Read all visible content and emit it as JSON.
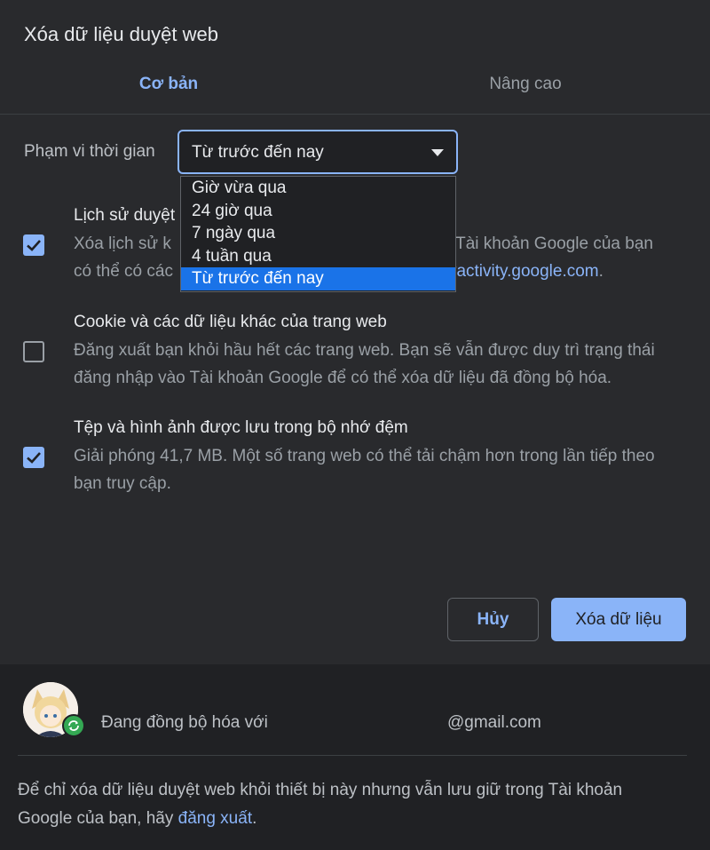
{
  "dialog": {
    "title": "Xóa dữ liệu duyệt web"
  },
  "tabs": [
    {
      "label": "Cơ bản",
      "active": true
    },
    {
      "label": "Nâng cao",
      "active": false
    }
  ],
  "time_range": {
    "label": "Phạm vi thời gian",
    "selected": "Từ trước đến nay",
    "options": [
      "Giờ vừa qua",
      "24 giờ qua",
      "7 ngày qua",
      "4 tuần qua",
      "Từ trước đến nay"
    ]
  },
  "items": [
    {
      "title": "Lịch sử duyệt",
      "desc_line1_start": "Xóa lịch sử k",
      "desc_line1_end": ". Tài khoản Google của bạn",
      "desc_line2_start": "có thể có các",
      "link_text": "yactivity.google.com",
      "desc_line2_end": ".",
      "checked": true
    },
    {
      "title": "Cookie và các dữ liệu khác của trang web",
      "desc": "Đăng xuất bạn khỏi hầu hết các trang web. Bạn sẽ vẫn được duy trì trạng thái đăng nhập vào Tài khoản Google để có thể xóa dữ liệu đã đồng bộ hóa.",
      "checked": false
    },
    {
      "title": "Tệp và hình ảnh được lưu trong bộ nhớ đệm",
      "desc": "Giải phóng 41,7 MB. Một số trang web có thể tải chậm hơn trong lần tiếp theo bạn truy cập.",
      "checked": true
    }
  ],
  "buttons": {
    "cancel": "Hủy",
    "clear": "Xóa dữ liệu"
  },
  "footer": {
    "sync_text": "Đang đồng bộ hóa với",
    "email": "@gmail.com",
    "note_prefix": "Để chỉ xóa dữ liệu duyệt web khỏi thiết bị này nhưng vẫn lưu giữ trong Tài khoản Google của bạn, hãy ",
    "note_link": "đăng xuất",
    "note_suffix": "."
  },
  "colors": {
    "accent": "#8ab4f8",
    "selected_option": "#1a73e8",
    "sync_badge": "#34a853"
  }
}
